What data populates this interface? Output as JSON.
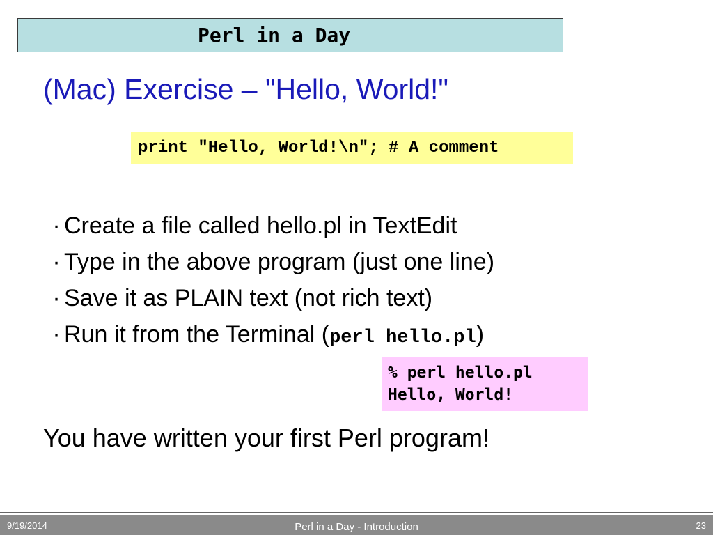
{
  "banner": {
    "title": "Perl in a Day"
  },
  "heading": "(Mac) Exercise – \"Hello, World!\"",
  "code_example": "print \"Hello, World!\\n\"; # A comment",
  "bullet_marker": "·",
  "bullets": [
    {
      "text": "Create a file called hello.pl in TextEdit"
    },
    {
      "text": "Type in the above program (just one line)"
    },
    {
      "text": "Save it as PLAIN text (not rich text)"
    },
    {
      "text_before": "Run it from the Terminal (",
      "code": "perl hello.pl",
      "text_after": ")"
    }
  ],
  "terminal": {
    "lines": [
      "% perl hello.pl",
      "Hello, World!"
    ]
  },
  "conclusion": "You have written your first Perl program!",
  "footer": {
    "date": "9/19/2014",
    "title": "Perl in a Day - Introduction",
    "page": "23"
  },
  "colors": {
    "banner_background": "#b7dfe1",
    "heading_text": "#1a1ab8",
    "code_box_background": "#ffff99",
    "terminal_box_background": "#ffccff",
    "footer_background": "#8a8a8a"
  }
}
